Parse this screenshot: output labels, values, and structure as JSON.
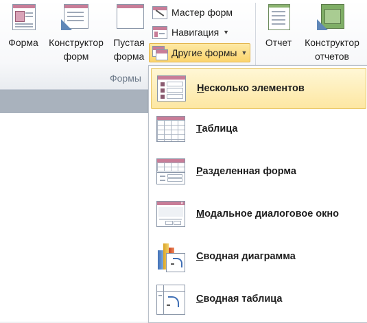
{
  "ribbon": {
    "buttons": {
      "form": {
        "line1": "Форма",
        "line2": ""
      },
      "form_designer": {
        "line1": "Конструктор",
        "line2": "форм"
      },
      "blank_form": {
        "line1": "Пустая",
        "line2": "форма"
      },
      "report": {
        "line1": "Отчет",
        "line2": ""
      },
      "report_designer": {
        "line1": "Конструктор",
        "line2": "отчетов"
      }
    },
    "small_buttons": {
      "form_wizard": "Мастер форм",
      "navigation": "Навигация",
      "other_forms": "Другие формы"
    },
    "group_label": "Формы"
  },
  "dropdown": {
    "items": [
      {
        "label": "Несколько элементов",
        "accel": "Н",
        "rest": "есколько элементов"
      },
      {
        "label": "Таблица",
        "accel": "Т",
        "rest": "аблица"
      },
      {
        "label": "Разделенная форма",
        "accel": "Р",
        "rest": "азделенная форма"
      },
      {
        "label": "Модальное диалоговое окно",
        "accel": "М",
        "rest": "одальное диалоговое окно"
      },
      {
        "label": "Сводная диаграмма",
        "accel": "С",
        "rest": "водная диаграмма"
      },
      {
        "label": "Сводная таблица",
        "accel": "С",
        "rest": "водная таблица"
      }
    ]
  },
  "icons": {
    "form": "form-icon",
    "form_designer": "form-designer-icon",
    "blank_form": "blank-form-icon",
    "form_wizard": "form-wizard-icon",
    "navigation": "navigation-icon",
    "other_forms": "other-forms-icon",
    "report": "report-icon",
    "report_designer": "report-designer-icon",
    "multiple_items": "multiple-items-icon",
    "datasheet": "datasheet-icon",
    "split_form": "split-form-icon",
    "modal_dialog": "modal-dialog-icon",
    "pivot_chart": "pivot-chart-icon",
    "pivot_table": "pivot-table-icon"
  }
}
